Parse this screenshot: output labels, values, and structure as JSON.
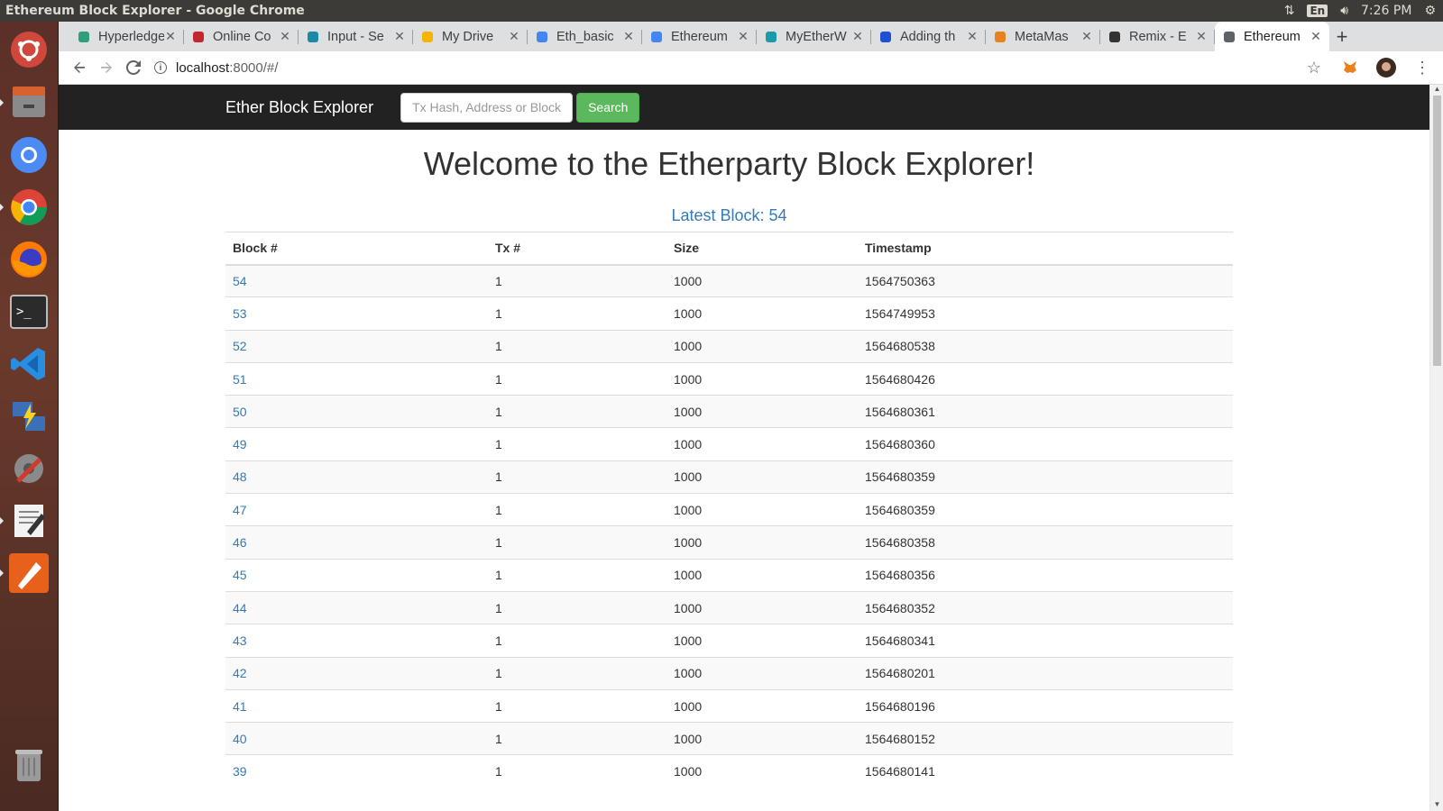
{
  "os": {
    "window_title": "Ethereum Block Explorer - Google Chrome",
    "lang": "En",
    "clock": "7:26 PM"
  },
  "launcher": [
    {
      "name": "ubuntu-dash-icon"
    },
    {
      "name": "files-icon"
    },
    {
      "name": "chromium-icon"
    },
    {
      "name": "chrome-icon"
    },
    {
      "name": "firefox-icon"
    },
    {
      "name": "terminal-icon"
    },
    {
      "name": "vscode-icon"
    },
    {
      "name": "network-icon"
    },
    {
      "name": "system-settings-icon"
    },
    {
      "name": "text-editor-icon"
    },
    {
      "name": "pen-tool-icon"
    },
    {
      "name": "trash-icon"
    }
  ],
  "tabs": [
    {
      "label": "Hyperledger",
      "icon": "hyperledger-icon",
      "color": "#2f9e7a"
    },
    {
      "label": "Online Co",
      "icon": "coursera-icon",
      "color": "#c1272d"
    },
    {
      "label": "Input - Se",
      "icon": "react-icon",
      "color": "#1a8aa8"
    },
    {
      "label": "My Drive",
      "icon": "drive-icon",
      "color": "#f4b400"
    },
    {
      "label": "Eth_basic",
      "icon": "docs-icon",
      "color": "#4285f4"
    },
    {
      "label": "Ethereum",
      "icon": "docs-icon",
      "color": "#4285f4"
    },
    {
      "label": "MyEtherW",
      "icon": "myetherwallet-icon",
      "color": "#1b9aaa"
    },
    {
      "label": "Adding th",
      "icon": "feather-icon",
      "color": "#1f4fd6"
    },
    {
      "label": "MetaMas",
      "icon": "metamask-icon",
      "color": "#e8821e"
    },
    {
      "label": "Remix - E",
      "icon": "ethereum-icon",
      "color": "#333333"
    },
    {
      "label": "Ethereum",
      "icon": "globe-icon",
      "color": "#5f6368",
      "active": true
    }
  ],
  "address_bar": {
    "host": "localhost",
    "path": ":8000/#/"
  },
  "navbar": {
    "brand": "Ether Block Explorer",
    "search_placeholder": "Tx Hash, Address or Block",
    "search_button": "Search"
  },
  "page": {
    "heading": "Welcome to the Etherparty Block Explorer!",
    "latest_block": "Latest Block: 54"
  },
  "table": {
    "headers": [
      "Block #",
      "Tx #",
      "Size",
      "Timestamp"
    ],
    "rows": [
      [
        "54",
        "1",
        "1000",
        "1564750363"
      ],
      [
        "53",
        "1",
        "1000",
        "1564749953"
      ],
      [
        "52",
        "1",
        "1000",
        "1564680538"
      ],
      [
        "51",
        "1",
        "1000",
        "1564680426"
      ],
      [
        "50",
        "1",
        "1000",
        "1564680361"
      ],
      [
        "49",
        "1",
        "1000",
        "1564680360"
      ],
      [
        "48",
        "1",
        "1000",
        "1564680359"
      ],
      [
        "47",
        "1",
        "1000",
        "1564680359"
      ],
      [
        "46",
        "1",
        "1000",
        "1564680358"
      ],
      [
        "45",
        "1",
        "1000",
        "1564680356"
      ],
      [
        "44",
        "1",
        "1000",
        "1564680352"
      ],
      [
        "43",
        "1",
        "1000",
        "1564680341"
      ],
      [
        "42",
        "1",
        "1000",
        "1564680201"
      ],
      [
        "41",
        "1",
        "1000",
        "1564680196"
      ],
      [
        "40",
        "1",
        "1000",
        "1564680152"
      ],
      [
        "39",
        "1",
        "1000",
        "1564680141"
      ]
    ]
  }
}
